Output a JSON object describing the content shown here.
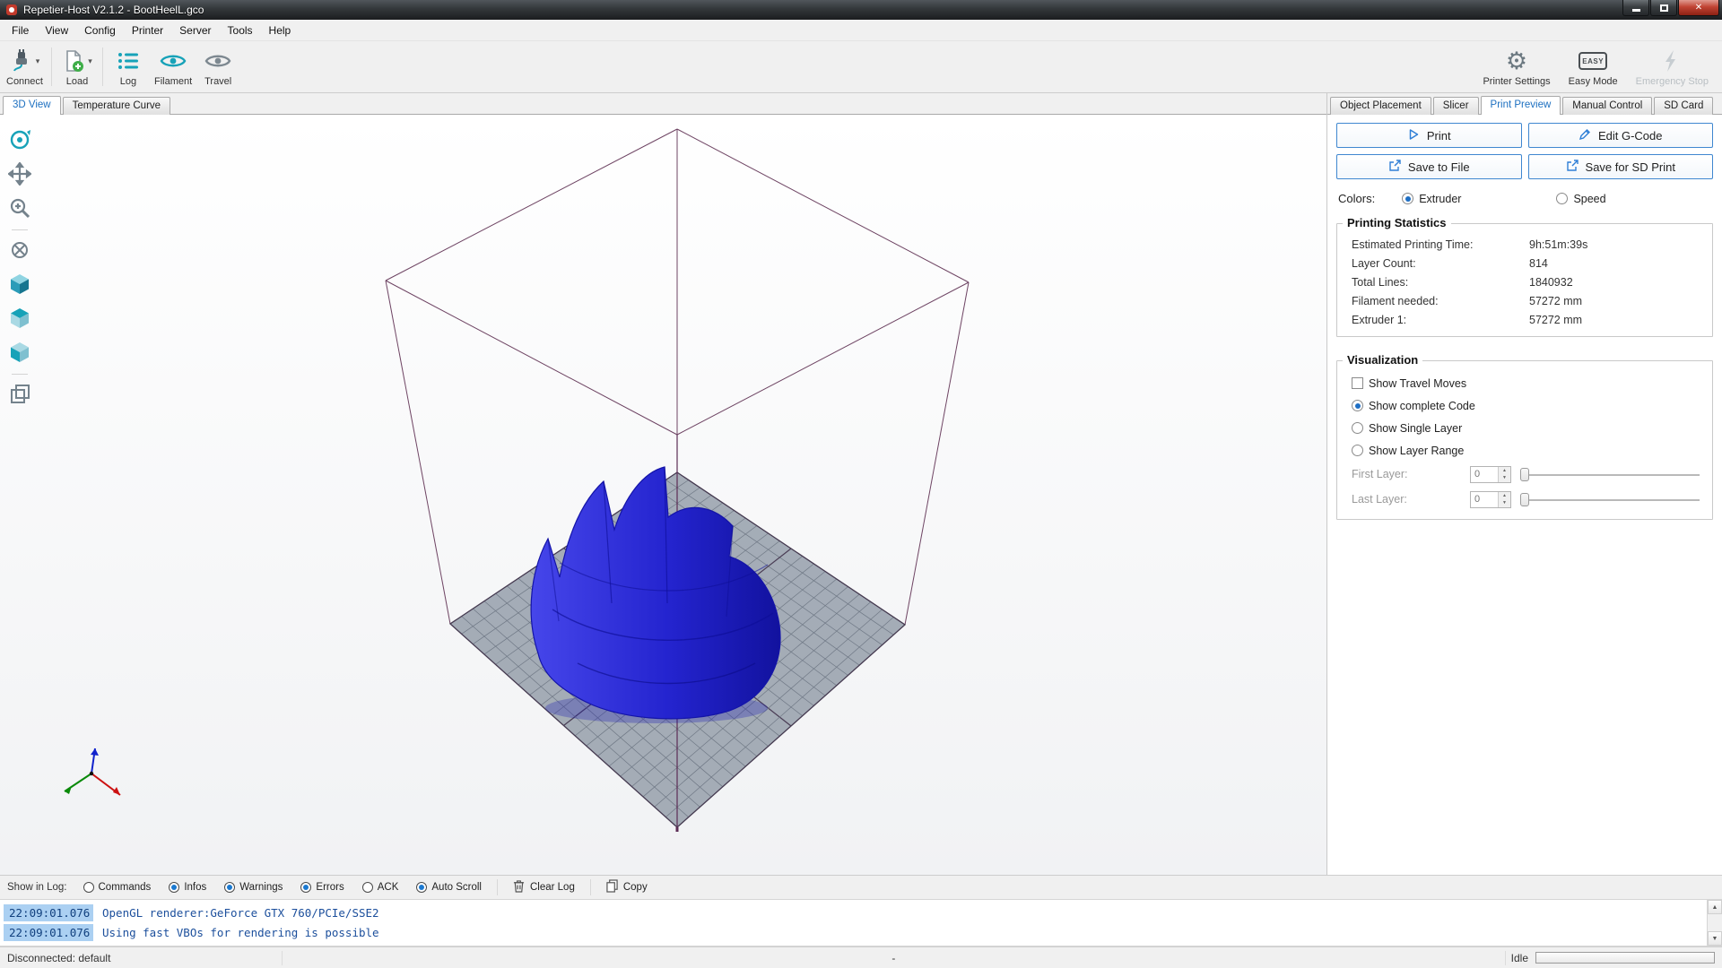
{
  "window": {
    "title": "Repetier-Host V2.1.2 - BootHeelL.gco"
  },
  "menu": {
    "items": [
      "File",
      "View",
      "Config",
      "Printer",
      "Server",
      "Tools",
      "Help"
    ]
  },
  "toolbar": {
    "connect": "Connect",
    "load": "Load",
    "log": "Log",
    "filament": "Filament",
    "travel": "Travel",
    "printer_settings": "Printer Settings",
    "easy_mode": "Easy Mode",
    "easy_badge": "EASY",
    "emergency_stop": "Emergency Stop"
  },
  "view_tabs": {
    "view3d": "3D View",
    "temperature": "Temperature Curve"
  },
  "right_tabs": {
    "object_placement": "Object Placement",
    "slicer": "Slicer",
    "print_preview": "Print Preview",
    "manual_control": "Manual Control",
    "sd_card": "SD Card"
  },
  "print_preview": {
    "print": "Print",
    "edit_gcode": "Edit G-Code",
    "save_to_file": "Save to File",
    "save_sd": "Save for SD Print",
    "colors_label": "Colors:",
    "extruder": "Extruder",
    "speed": "Speed",
    "stats": {
      "title": "Printing Statistics",
      "rows": [
        {
          "label": "Estimated Printing Time:",
          "value": "9h:51m:39s"
        },
        {
          "label": "Layer Count:",
          "value": "814"
        },
        {
          "label": "Total Lines:",
          "value": "1840932"
        },
        {
          "label": "Filament needed:",
          "value": "57272 mm"
        },
        {
          "label": "Extruder 1:",
          "value": "57272 mm"
        }
      ]
    },
    "visualization": {
      "title": "Visualization",
      "show_travel": "Show Travel Moves",
      "show_complete": "Show complete Code",
      "show_single": "Show Single Layer",
      "show_range": "Show Layer Range",
      "first_layer": "First Layer:",
      "last_layer": "Last Layer:",
      "first_value": "0",
      "last_value": "0"
    }
  },
  "log": {
    "show_label": "Show in Log:",
    "toggles": [
      {
        "label": "Commands"
      },
      {
        "label": "Infos"
      },
      {
        "label": "Warnings"
      },
      {
        "label": "Errors"
      },
      {
        "label": "ACK"
      },
      {
        "label": "Auto Scroll"
      }
    ],
    "clear": "Clear Log",
    "copy": "Copy",
    "entries": [
      {
        "time": "22:09:01.076",
        "message": "OpenGL renderer:GeForce GTX 760/PCIe/SSE2"
      },
      {
        "time": "22:09:01.076",
        "message": "Using fast VBOs for rendering is possible"
      }
    ]
  },
  "status": {
    "connection": "Disconnected: default",
    "center": "-",
    "state": "Idle"
  },
  "colors": {
    "accent_blue": "#1c6fc0",
    "button_border": "#3f87d0",
    "model_blue": "#2a2ad0",
    "teal": "#17a2b8"
  }
}
